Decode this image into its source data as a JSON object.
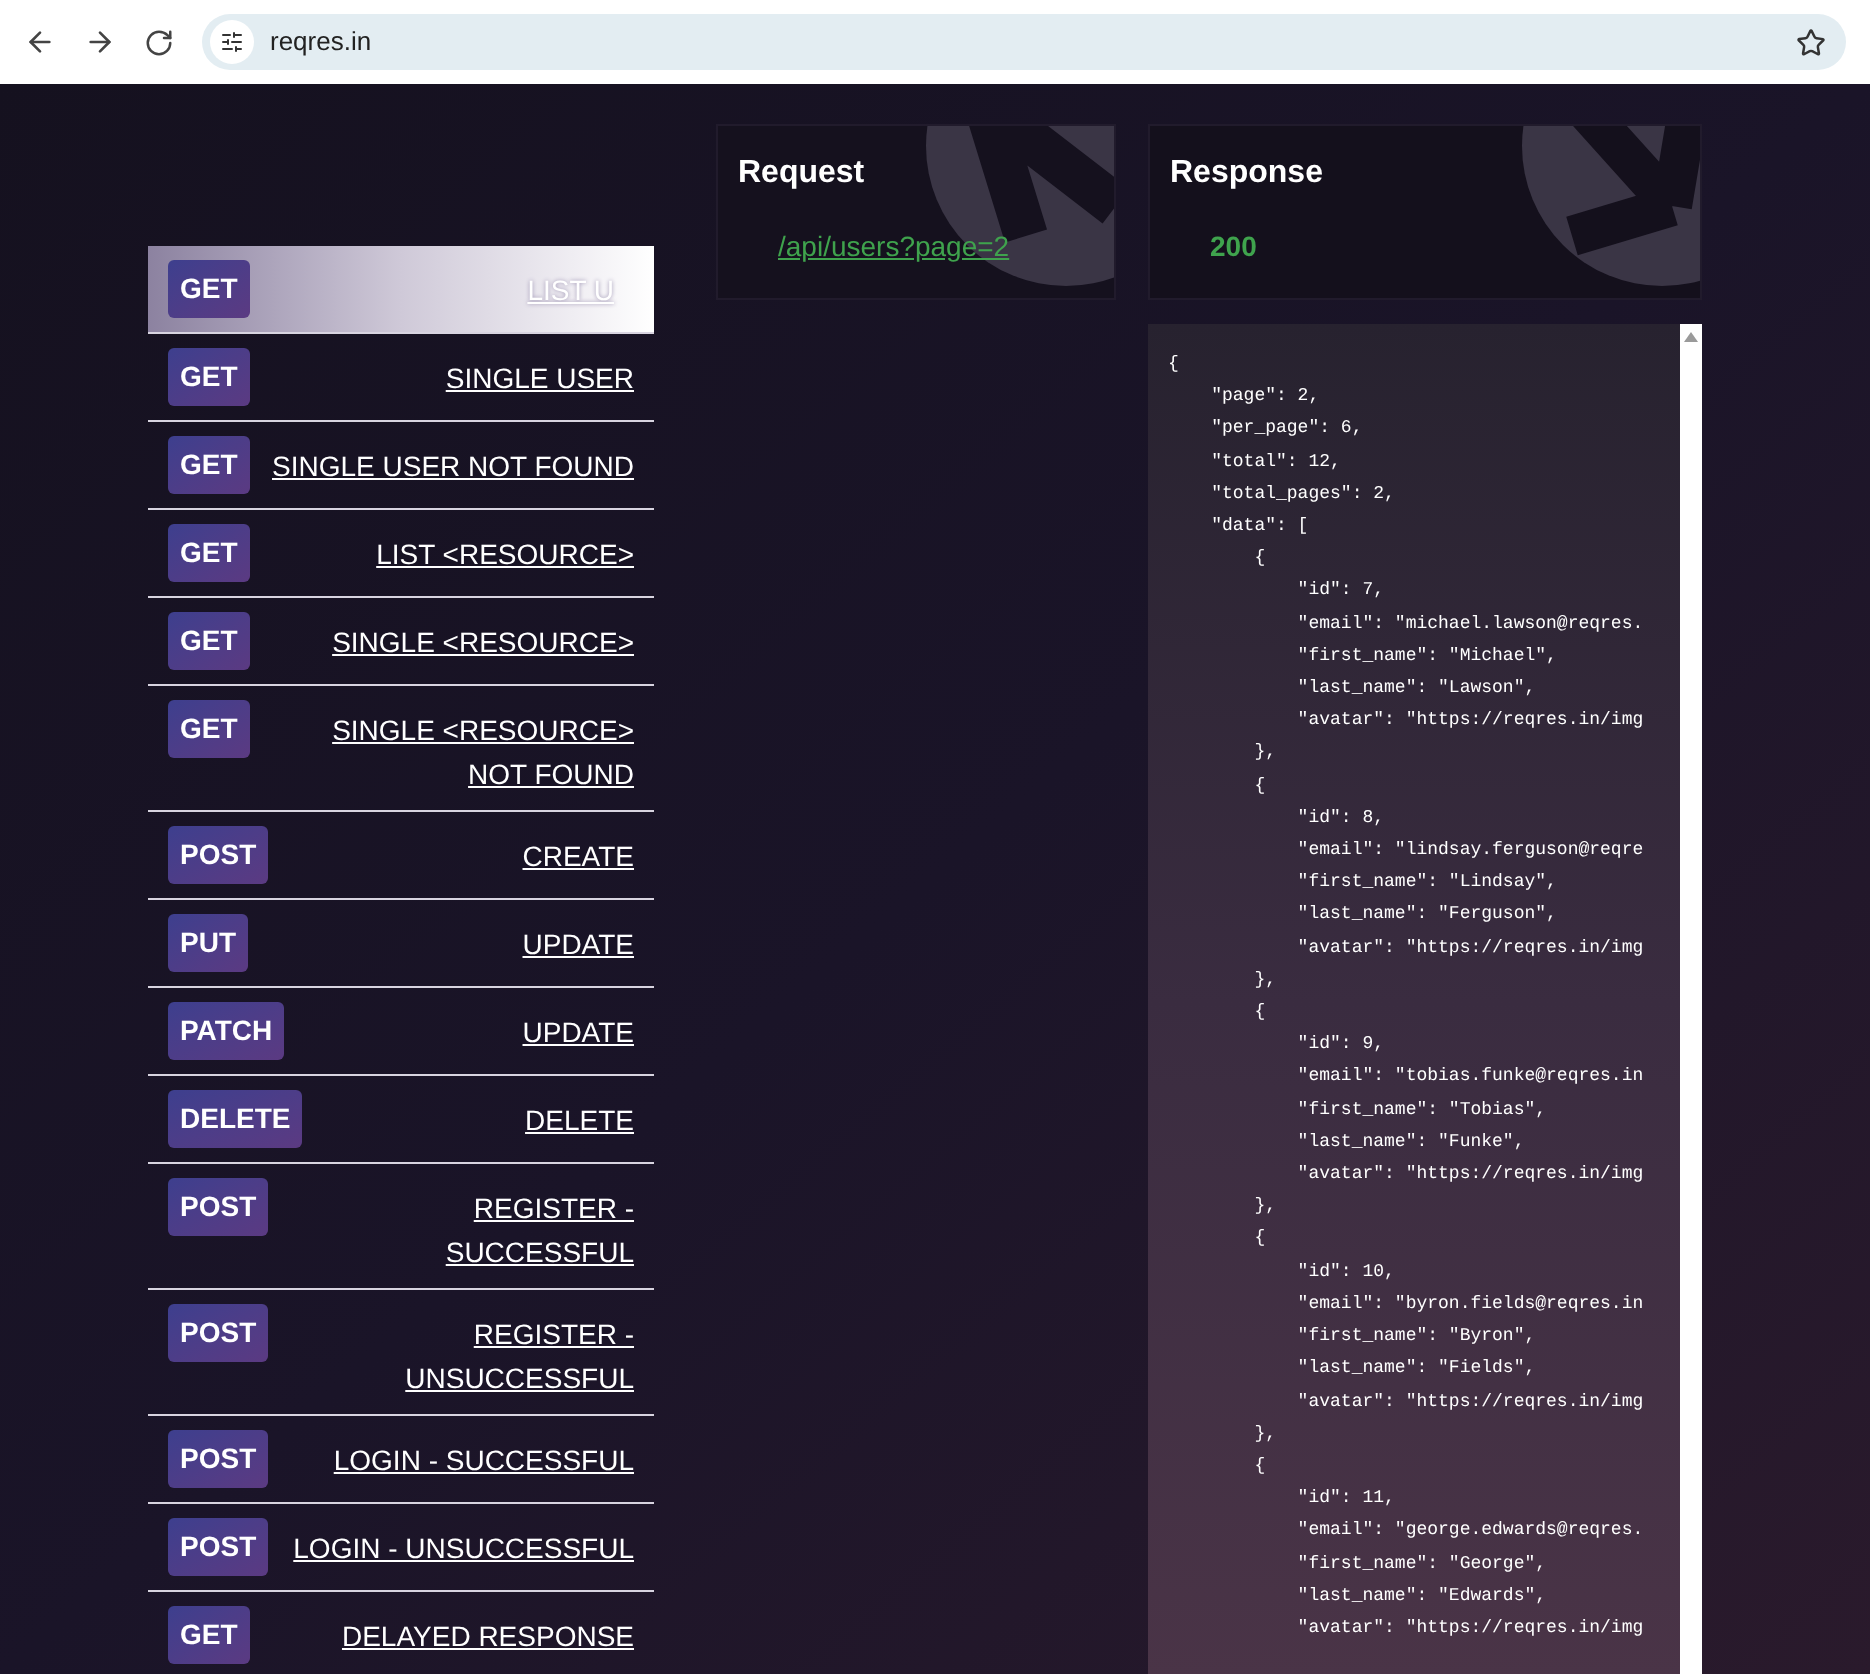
{
  "browser": {
    "address": "reqres.in"
  },
  "endpoints": [
    {
      "method": "GET",
      "label": "LIST U",
      "selected": true
    },
    {
      "method": "GET",
      "label": "SINGLE USER",
      "selected": false
    },
    {
      "method": "GET",
      "label": "SINGLE USER NOT FOUND",
      "selected": false
    },
    {
      "method": "GET",
      "label": "LIST <RESOURCE>",
      "selected": false
    },
    {
      "method": "GET",
      "label": "SINGLE <RESOURCE>",
      "selected": false
    },
    {
      "method": "GET",
      "label": "SINGLE <RESOURCE> NOT FOUND",
      "selected": false
    },
    {
      "method": "POST",
      "label": "CREATE",
      "selected": false
    },
    {
      "method": "PUT",
      "label": "UPDATE",
      "selected": false
    },
    {
      "method": "PATCH",
      "label": "UPDATE",
      "selected": false
    },
    {
      "method": "DELETE",
      "label": "DELETE",
      "selected": false
    },
    {
      "method": "POST",
      "label": "REGISTER - SUCCESSFUL",
      "selected": false
    },
    {
      "method": "POST",
      "label": "REGISTER - UNSUCCESSFUL",
      "selected": false
    },
    {
      "method": "POST",
      "label": "LOGIN - SUCCESSFUL",
      "selected": false
    },
    {
      "method": "POST",
      "label": "LOGIN - UNSUCCESSFUL",
      "selected": false
    },
    {
      "method": "GET",
      "label": "DELAYED RESPONSE",
      "selected": false
    }
  ],
  "request": {
    "title": "Request",
    "url": "/api/users?page=2"
  },
  "response": {
    "title": "Response",
    "status": "200",
    "body": [
      "{",
      "    \"page\": 2,",
      "    \"per_page\": 6,",
      "    \"total\": 12,",
      "    \"total_pages\": 2,",
      "    \"data\": [",
      "        {",
      "            \"id\": 7,",
      "            \"email\": \"michael.lawson@reqres.",
      "            \"first_name\": \"Michael\",",
      "            \"last_name\": \"Lawson\",",
      "            \"avatar\": \"https://reqres.in/img",
      "        },",
      "        {",
      "            \"id\": 8,",
      "            \"email\": \"lindsay.ferguson@reqre",
      "            \"first_name\": \"Lindsay\",",
      "            \"last_name\": \"Ferguson\",",
      "            \"avatar\": \"https://reqres.in/img",
      "        },",
      "        {",
      "            \"id\": 9,",
      "            \"email\": \"tobias.funke@reqres.in",
      "            \"first_name\": \"Tobias\",",
      "            \"last_name\": \"Funke\",",
      "            \"avatar\": \"https://reqres.in/img",
      "        },",
      "        {",
      "            \"id\": 10,",
      "            \"email\": \"byron.fields@reqres.in",
      "            \"first_name\": \"Byron\",",
      "            \"last_name\": \"Fields\",",
      "            \"avatar\": \"https://reqres.in/img",
      "        },",
      "        {",
      "            \"id\": 11,",
      "            \"email\": \"george.edwards@reqres.",
      "            \"first_name\": \"George\",",
      "            \"last_name\": \"Edwards\",",
      "            \"avatar\": \"https://reqres.in/img"
    ]
  }
}
